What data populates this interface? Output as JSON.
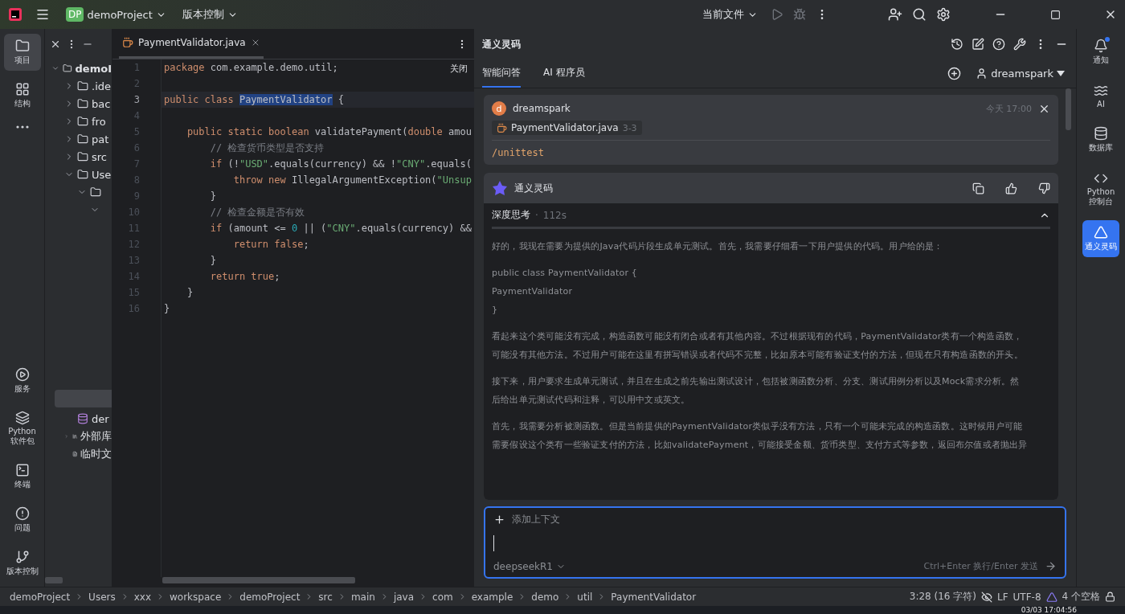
{
  "title_bar": {
    "project_badge": "DP",
    "project": "demoProject",
    "vcs": "版本控制",
    "run_config": "当前文件"
  },
  "left_tools": [
    {
      "label": "项目",
      "selected": true
    },
    {
      "label": "结构",
      "selected": false
    },
    {
      "selected": false
    }
  ],
  "left_tools_bottom": [
    {
      "label": "服务"
    },
    {
      "label": "Python 软件包"
    },
    {
      "label": "终端"
    },
    {
      "label": "问题"
    },
    {
      "label": "版本控制"
    }
  ],
  "project_tree": [
    {
      "label": "demoI",
      "kind": "module",
      "expanded": true,
      "bold": true,
      "children": [
        {
          "label": ".ide",
          "kind": "folder",
          "expanded": false,
          "bold": false
        },
        {
          "label": "bac",
          "kind": "folder",
          "expanded": false,
          "bold": false
        },
        {
          "label": "fro",
          "kind": "folder",
          "expanded": false,
          "bold": false
        },
        {
          "label": "pat",
          "kind": "folder",
          "expanded": false,
          "bold": false
        },
        {
          "label": "src",
          "kind": "folder",
          "expanded": false,
          "bold": false
        },
        {
          "label": "Use",
          "kind": "folder",
          "expanded": true,
          "bold": false,
          "children": [
            {
              "kind": "folder",
              "expanded": true,
              "children": [
                {
                  "expanded": true
                }
              ]
            }
          ]
        }
      ]
    }
  ],
  "project_tree_lower": [
    {
      "label": "der",
      "kind": "database",
      "bold": false
    },
    {
      "label": "外部库",
      "kind": "library",
      "expanded": false,
      "bold": false
    },
    {
      "label": "临时文",
      "kind": "scratch",
      "bold": false
    }
  ],
  "editor": {
    "tab": "PaymentValidator.java",
    "close_hint": "关闭",
    "lines": [
      {
        "n": "1",
        "current": false,
        "tokens": [
          {
            "kind": "kw",
            "t": "package"
          },
          {
            "kind": "plain",
            "t": " com.example.demo.util;"
          }
        ]
      },
      {
        "n": "2",
        "current": false
      },
      {
        "n": "3",
        "current": true,
        "tokens": [
          {
            "kind": "kw",
            "t": "public class "
          },
          {
            "kind": "sel",
            "t": "PaymentValidator"
          },
          {
            "kind": "plain",
            "t": " {"
          }
        ]
      },
      {
        "n": "4",
        "current": false
      },
      {
        "n": "5",
        "current": false,
        "tokens": [
          {
            "kind": "kw",
            "t": "    public static boolean "
          },
          {
            "kind": "plain",
            "t": "validatePayment("
          },
          {
            "kind": "kw",
            "t": "double "
          },
          {
            "kind": "plain",
            "t": "amou"
          }
        ]
      },
      {
        "n": "6",
        "current": false,
        "tokens": [
          {
            "kind": "comment",
            "t": "        // 检查货币类型是否支持"
          }
        ]
      },
      {
        "n": "7",
        "current": false,
        "tokens": [
          {
            "kind": "kw",
            "t": "        if "
          },
          {
            "kind": "plain",
            "t": "(!"
          },
          {
            "kind": "str",
            "t": "\"USD\""
          },
          {
            "kind": "plain",
            "t": ".equals(currency) && !"
          },
          {
            "kind": "str",
            "t": "\"CNY\""
          },
          {
            "kind": "plain",
            "t": ".equals("
          }
        ]
      },
      {
        "n": "8",
        "current": false,
        "tokens": [
          {
            "kind": "kw",
            "t": "            throw new "
          },
          {
            "kind": "plain",
            "t": "IllegalArgumentException("
          },
          {
            "kind": "str",
            "t": "\"Unsup"
          }
        ]
      },
      {
        "n": "9",
        "current": false,
        "tokens": [
          {
            "kind": "plain",
            "t": "        }"
          }
        ]
      },
      {
        "n": "10",
        "current": false,
        "tokens": [
          {
            "kind": "comment",
            "t": "        // 检查金额是否有效"
          }
        ]
      },
      {
        "n": "11",
        "current": false,
        "tokens": [
          {
            "kind": "kw",
            "t": "        if "
          },
          {
            "kind": "plain",
            "t": "(amount <= "
          },
          {
            "kind": "num",
            "t": "0"
          },
          {
            "kind": "plain",
            "t": " || ("
          },
          {
            "kind": "str",
            "t": "\"CNY\""
          },
          {
            "kind": "plain",
            "t": ".equals(currency) &&"
          }
        ]
      },
      {
        "n": "12",
        "current": false,
        "tokens": [
          {
            "kind": "kw",
            "t": "            return false"
          },
          {
            "kind": "plain",
            "t": ";"
          }
        ]
      },
      {
        "n": "13",
        "current": false,
        "tokens": [
          {
            "kind": "plain",
            "t": "        }"
          }
        ]
      },
      {
        "n": "14",
        "current": false,
        "tokens": [
          {
            "kind": "kw",
            "t": "        return true"
          },
          {
            "kind": "plain",
            "t": ";"
          }
        ]
      },
      {
        "n": "15",
        "current": false,
        "tokens": [
          {
            "kind": "plain",
            "t": "    }"
          }
        ]
      },
      {
        "n": "16",
        "current": false,
        "tokens": [
          {
            "kind": "plain",
            "t": "}"
          }
        ]
      }
    ]
  },
  "ai_panel": {
    "title": "通义灵码",
    "tabs": [
      {
        "label": "智能问答",
        "selected": true
      },
      {
        "label": "AI 程序员",
        "selected": false
      }
    ],
    "account": "dreamspark",
    "user_message": {
      "avatar": "d",
      "author": "dreamspark",
      "time": "今天 17:00",
      "file": "PaymentValidator.java",
      "range": "3-3",
      "command": "/unittest"
    },
    "reply": {
      "author": "通义灵码",
      "thinking_title": "深度思考",
      "separator": "·",
      "thinking_time": "112s",
      "expanded": true,
      "paragraphs": [
        [
          "好的，我现在需要为提供的Java代码片段生成单元测试。首先，我需要仔细看一下用户提供的代码。用户给的是："
        ],
        [
          "public class PaymentValidator {",
          "PaymentValidator",
          "}"
        ],
        [
          "看起来这个类可能没有完成，构造函数可能没有闭合或者有其他内容。不过根据现有的代码，PaymentValidator类有一个构造函数，",
          "可能没有其他方法。不过用户可能在这里有拼写错误或者代码不完整，比如原本可能有验证支付的方法，但现在只有构造函数的开头。"
        ],
        [
          "接下来，用户要求生成单元测试，并且在生成之前先输出测试设计，包括被测函数分析、分支、测试用例分析以及Mock需求分析。然",
          "后给出单元测试代码和注释，可以用中文或英文。"
        ],
        [
          "首先，我需要分析被测函数。但是当前提供的PaymentValidator类似乎没有方法，只有一个可能未完成的构造函数。这时候用户可能",
          "需要假设这个类有一些验证支付的方法，比如validatePayment，可能接受金额、货币类型、支付方式等参数，返回布尔值或者抛出异"
        ]
      ]
    },
    "input": {
      "add_context": "添加上下文",
      "model": "deepseekR1",
      "hint": "Ctrl+Enter 换行/Enter 发送"
    }
  },
  "right_tools": [
    {
      "label": "通知",
      "selected": false,
      "badge": true
    },
    {
      "label": "AI",
      "selected": false,
      "badge": false
    },
    {
      "label": "数据库",
      "selected": false,
      "badge": false
    },
    {
      "label": "Python 控制台",
      "selected": false,
      "badge": false
    },
    {
      "label": "通义灵码",
      "selected": true,
      "badge": false
    }
  ],
  "status_bar": {
    "breadcrumbs": [
      "demoProject",
      "Users",
      "xxx",
      "workspace",
      "demoProject",
      "src",
      "main",
      "java",
      "com",
      "example",
      "demo",
      "util",
      "PaymentValidator"
    ],
    "position": "3:28 (16 字符)",
    "line_sep": "LF",
    "encoding": "UTF-8",
    "indent": "4 个空格"
  },
  "taskbar": {
    "clock": "03/03 17:04:56"
  }
}
